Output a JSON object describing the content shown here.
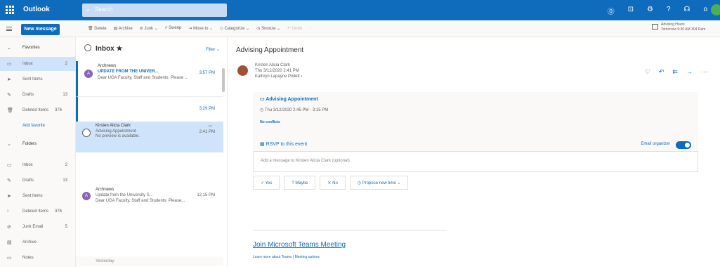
{
  "app": {
    "title": "Outlook",
    "search_placeholder": "Search"
  },
  "toolbar": {
    "new_message": "New message",
    "commands": [
      "Delete",
      "Archive",
      "Junk",
      "Sweep",
      "Move to",
      "Categorize",
      "Snooze",
      "Undo",
      "···"
    ],
    "advising_title": "Advising Hours",
    "advising_time": "Tomorrow 9:30 AM 304 Ram"
  },
  "folders": {
    "favorites_label": "Favorites",
    "favorites": [
      {
        "label": "Inbox",
        "count": "2",
        "icon": "inbox-icon"
      },
      {
        "label": "Sent Items",
        "count": "",
        "icon": "send-icon"
      },
      {
        "label": "Drafts",
        "count": "13",
        "icon": "pencil-icon"
      },
      {
        "label": "Deleted Items",
        "count": "376",
        "icon": "trash-icon"
      }
    ],
    "add_favorite": "Add favorite",
    "folders_label": "Folders",
    "folders": [
      {
        "label": "Inbox",
        "count": "2",
        "icon": "inbox-icon"
      },
      {
        "label": "Drafts",
        "count": "13",
        "icon": "pencil-icon"
      },
      {
        "label": "Sent Items",
        "count": "",
        "icon": "send-icon"
      },
      {
        "label": "Deleted Items",
        "count": "376",
        "icon": "chevron-right-icon"
      },
      {
        "label": "Junk Email",
        "count": "5",
        "icon": "junk-icon"
      },
      {
        "label": "Archive",
        "count": "",
        "icon": "archive-icon"
      },
      {
        "label": "Notes",
        "count": "",
        "icon": "notes-icon"
      }
    ]
  },
  "list": {
    "title": "Inbox",
    "filter": "Filter",
    "messages": [
      {
        "avatar": "A",
        "sender": "Archnews",
        "subject": "UPDATE FROM THE UNIVER...",
        "time": "3:57 PM",
        "preview": "Dear UGA Faculty, Staff and Students: Please ..."
      },
      {
        "time": "3:29 PM"
      },
      {
        "sender": "Kirsten Alicia Clark",
        "subject": "Advising Appointment",
        "time": "2:41 PM",
        "preview": "No preview is available."
      },
      {
        "avatar": "A",
        "sender": "Archnews",
        "subject": "Update from the University S...",
        "time": "12:15 PM",
        "preview": "Dear UGA Faculty, Staff and Students: Please..."
      }
    ],
    "yesterday": "Yesterday"
  },
  "reading": {
    "title": "Advising Appointment",
    "from": "Kirsten Alicia Clark",
    "date": "Thu 3/12/2020 2:41 PM",
    "to": "Kathryn Lapayne Pollett",
    "meeting_title": "Advising Appointment",
    "meeting_time": "Thu 3/12/2020 2:45 PM - 3:15 PM",
    "conflicts": "No conflicts",
    "rsvp": "RSVP to this event",
    "email_organizer": "Email organizer",
    "rsvp_placeholder": "Add a message to Kirsten Alicia Clark (optional)",
    "yes": "Yes",
    "maybe": "Maybe",
    "no": "No",
    "propose": "Propose new time",
    "teams_title": "Join Microsoft Teams Meeting",
    "learn_more": "Learn more about Teams",
    "meeting_options": "Meeting options"
  }
}
